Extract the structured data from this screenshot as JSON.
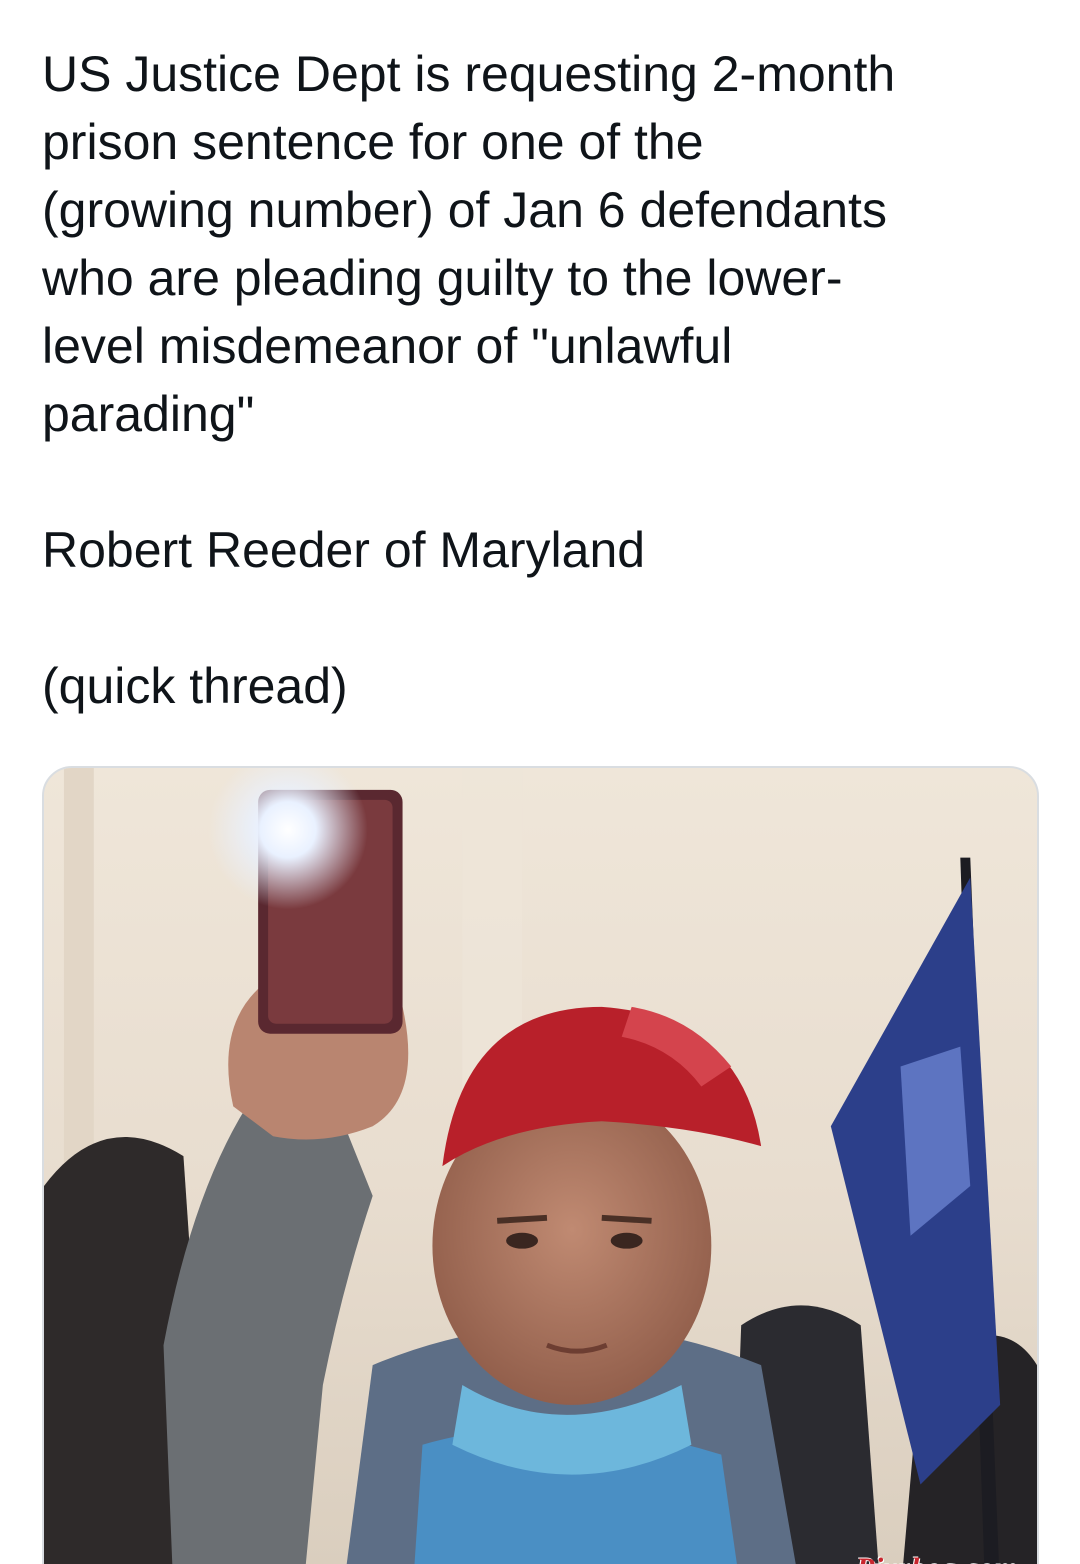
{
  "tweet": {
    "paragraphs": [
      "US Justice Dept is requesting 2-month\nprison sentence for one of the\n(growing number) of Jan 6 defendants\nwho are pleading guilty to the lower-\nlevel misdemeanor of \"unlawful\nparading\"",
      "Robert Reeder of Maryland",
      "(quick thread)"
    ]
  },
  "media": {
    "watermark": "Pixrbog.com",
    "background_color": "#eae0d2",
    "hat_color": "#b8202a"
  }
}
